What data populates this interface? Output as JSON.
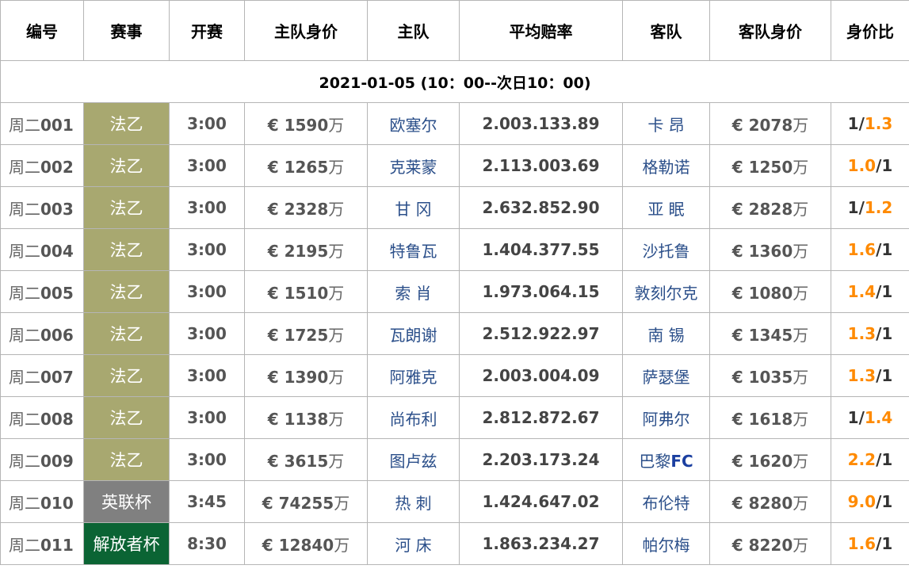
{
  "header": {
    "col_id": "编号",
    "col_league": "赛事",
    "col_time": "开赛",
    "col_home_value": "主队身价",
    "col_home": "主队",
    "col_odds": "平均赔率",
    "col_away": "客队",
    "col_away_value": "客队身价",
    "col_ratio": "身价比"
  },
  "date_label": "2021-01-05 (10：00--次日10：00)",
  "colors": {
    "league_ligue2": "#a8a870",
    "league_eflcup": "#808080",
    "league_libertadores": "#0b6434",
    "ratio_highlight": "#ff8a00",
    "team_text": "#2b4f8a"
  },
  "unit_wan": "万",
  "currency": "€",
  "rows": [
    {
      "day": "周二",
      "num": "001",
      "league": "法乙",
      "league_color": "#a8a870",
      "time": "3:00",
      "home_value": "€ 1590",
      "home": "欧塞尔",
      "odds": "2.003.133.89",
      "away": "卡 昂",
      "away_suffix": "",
      "away_value": "€ 2078",
      "ratio_left": "1/",
      "ratio_right": "1.3",
      "highlight": "right"
    },
    {
      "day": "周二",
      "num": "002",
      "league": "法乙",
      "league_color": "#a8a870",
      "time": "3:00",
      "home_value": "€ 1265",
      "home": "克莱蒙",
      "odds": "2.113.003.69",
      "away": "格勒诺",
      "away_suffix": "",
      "away_value": "€ 1250",
      "ratio_left": "1.0",
      "ratio_right": "/1",
      "highlight": "left"
    },
    {
      "day": "周二",
      "num": "003",
      "league": "法乙",
      "league_color": "#a8a870",
      "time": "3:00",
      "home_value": "€ 2328",
      "home": "甘 冈",
      "odds": "2.632.852.90",
      "away": "亚 眠",
      "away_suffix": "",
      "away_value": "€ 2828",
      "ratio_left": "1/",
      "ratio_right": "1.2",
      "highlight": "right"
    },
    {
      "day": "周二",
      "num": "004",
      "league": "法乙",
      "league_color": "#a8a870",
      "time": "3:00",
      "home_value": "€ 2195",
      "home": "特鲁瓦",
      "odds": "1.404.377.55",
      "away": "沙托鲁",
      "away_suffix": "",
      "away_value": "€ 1360",
      "ratio_left": "1.6",
      "ratio_right": "/1",
      "highlight": "left"
    },
    {
      "day": "周二",
      "num": "005",
      "league": "法乙",
      "league_color": "#a8a870",
      "time": "3:00",
      "home_value": "€ 1510",
      "home": "索 肖",
      "odds": "1.973.064.15",
      "away": "敦刻尔克",
      "away_suffix": "",
      "away_value": "€ 1080",
      "ratio_left": "1.4",
      "ratio_right": "/1",
      "highlight": "left"
    },
    {
      "day": "周二",
      "num": "006",
      "league": "法乙",
      "league_color": "#a8a870",
      "time": "3:00",
      "home_value": "€ 1725",
      "home": "瓦朗谢",
      "odds": "2.512.922.97",
      "away": "南 锡",
      "away_suffix": "",
      "away_value": "€ 1345",
      "ratio_left": "1.3",
      "ratio_right": "/1",
      "highlight": "left"
    },
    {
      "day": "周二",
      "num": "007",
      "league": "法乙",
      "league_color": "#a8a870",
      "time": "3:00",
      "home_value": "€ 1390",
      "home": "阿雅克",
      "odds": "2.003.004.09",
      "away": "萨瑟堡",
      "away_suffix": "",
      "away_value": "€ 1035",
      "ratio_left": "1.3",
      "ratio_right": "/1",
      "highlight": "left"
    },
    {
      "day": "周二",
      "num": "008",
      "league": "法乙",
      "league_color": "#a8a870",
      "time": "3:00",
      "home_value": "€ 1138",
      "home": "尚布利",
      "odds": "2.812.872.67",
      "away": "阿弗尔",
      "away_suffix": "",
      "away_value": "€ 1618",
      "ratio_left": "1/",
      "ratio_right": "1.4",
      "highlight": "right"
    },
    {
      "day": "周二",
      "num": "009",
      "league": "法乙",
      "league_color": "#a8a870",
      "time": "3:00",
      "home_value": "€ 3615",
      "home": "图卢兹",
      "odds": "2.203.173.24",
      "away": "巴黎",
      "away_suffix": "FC",
      "away_value": "€ 1620",
      "ratio_left": "2.2",
      "ratio_right": "/1",
      "highlight": "left"
    },
    {
      "day": "周二",
      "num": "010",
      "league": "英联杯",
      "league_color": "#808080",
      "time": "3:45",
      "home_value": "€ 74255",
      "home": "热 刺",
      "odds": "1.424.647.02",
      "away": "布伦特",
      "away_suffix": "",
      "away_value": "€ 8280",
      "ratio_left": "9.0",
      "ratio_right": "/1",
      "highlight": "left"
    },
    {
      "day": "周二",
      "num": "011",
      "league": "解放者杯",
      "league_color": "#0b6434",
      "time": "8:30",
      "home_value": "€ 12840",
      "home": "河 床",
      "odds": "1.863.234.27",
      "away": "帕尔梅",
      "away_suffix": "",
      "away_value": "€ 8220",
      "ratio_left": "1.6",
      "ratio_right": "/1",
      "highlight": "left"
    }
  ]
}
